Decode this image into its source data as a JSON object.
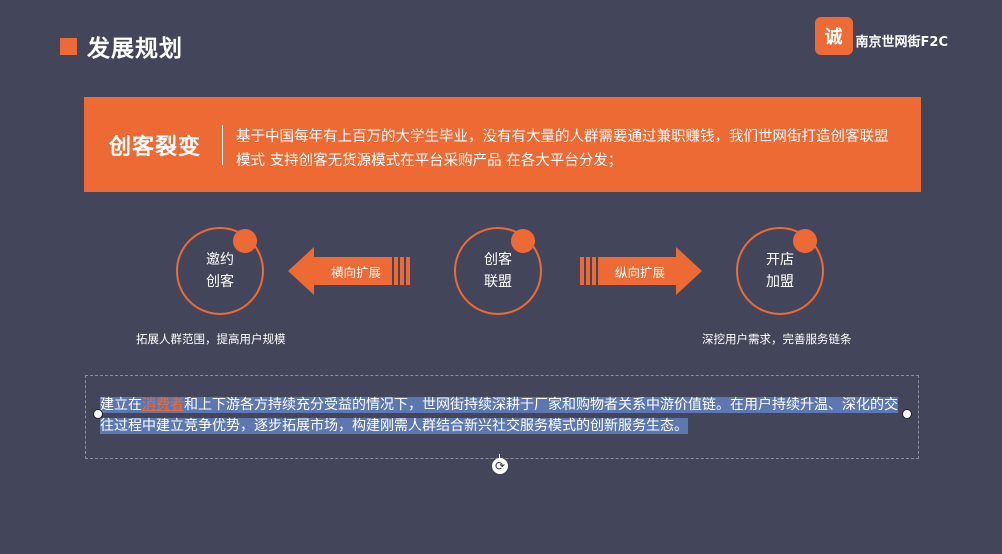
{
  "title": "发展规划",
  "logo": {
    "mark": "诚",
    "brand": "南京世网街F2C"
  },
  "banner": {
    "label": "创客裂变",
    "description": "基于中国每年有上百万的大学生毕业，没有有大量的人群需要通过兼职赚钱，我们世网街打造创客联盟模式 支持创客无货源模式在平台采购产品 在各大平台分发；"
  },
  "flow": {
    "left_circle": {
      "line1": "邀约",
      "line2": "创客"
    },
    "center_circle": {
      "line1": "创客",
      "line2": "联盟"
    },
    "right_circle": {
      "line1": "开店",
      "line2": "加盟"
    },
    "left_arrow_label": "横向扩展",
    "right_arrow_label": "纵向扩展",
    "left_caption": "拓展人群范围，提高用户规模",
    "right_caption": "深挖用户需求，完善服务链条"
  },
  "paragraph": {
    "before": "建立在",
    "highlight_word": "消费者",
    "after": "和上下游各方持续充分受益的情况下，世网街持续深耕于厂家和购物者关系中游价值链。在用户持续升温、深化的交往过程中建立竞争优势，逐步拓展市场，构建刚需人群结合新兴社交服务模式的创新服务生态。"
  },
  "colors": {
    "background": "#43465a",
    "accent": "#ee6a35",
    "selection": "#5d77b1"
  },
  "icons": {
    "rotate": "rotate-handle-icon"
  }
}
